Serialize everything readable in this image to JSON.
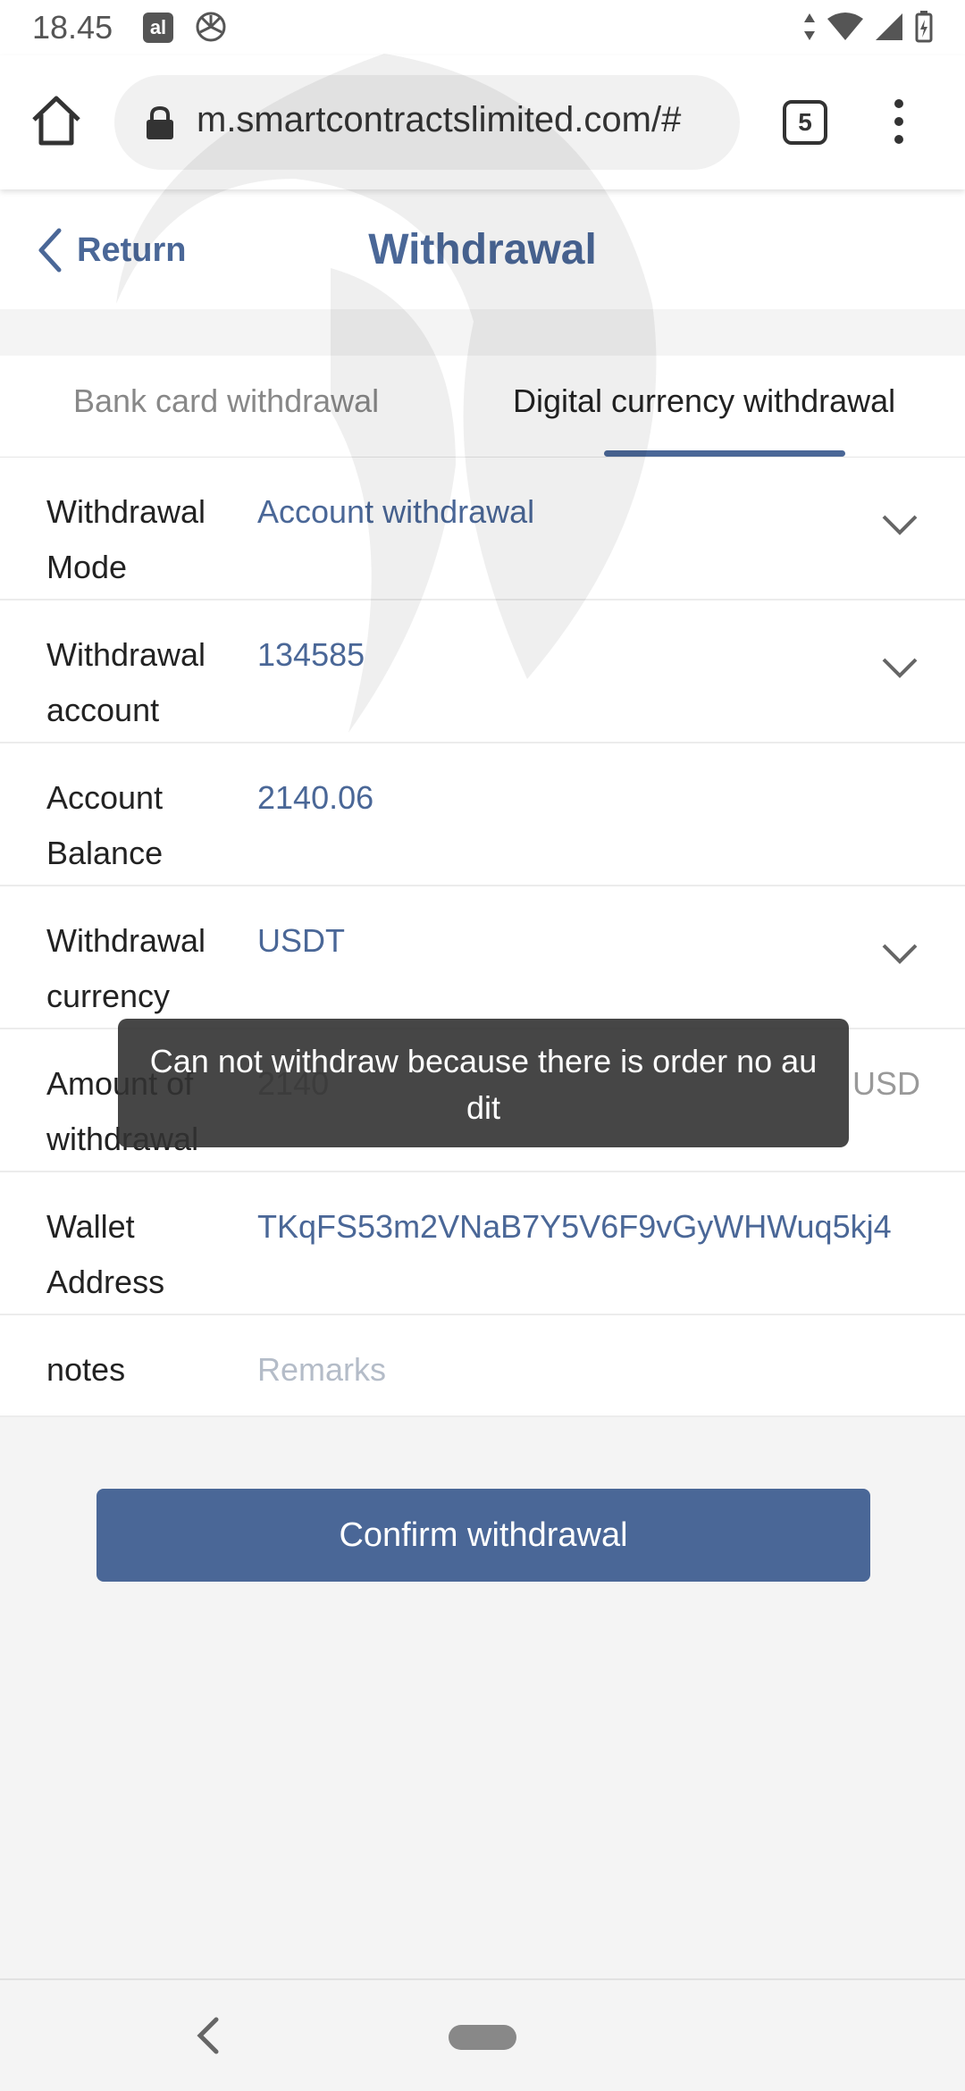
{
  "status_bar": {
    "time": "18.45",
    "app_icon_label": "al"
  },
  "browser": {
    "url": "m.smartcontractslimited.com/#",
    "tab_count": "5"
  },
  "header": {
    "return_label": "Return",
    "title": "Withdrawal"
  },
  "tabs": [
    {
      "label": "Bank card withdrawal",
      "active": false
    },
    {
      "label": "Digital currency withdrawal",
      "active": true
    }
  ],
  "form": {
    "withdrawal_mode": {
      "label": "Withdrawal Mode",
      "value": "Account withdrawal"
    },
    "withdrawal_account": {
      "label": "Withdrawal account",
      "value": "134585"
    },
    "account_balance": {
      "label": "Account Balance",
      "value": "2140.06"
    },
    "withdrawal_currency": {
      "label": "Withdrawal currency",
      "value": "USDT"
    },
    "amount": {
      "label": "Amount of withdrawal",
      "value": "2140",
      "unit": "USD"
    },
    "wallet_address": {
      "label": "Wallet Address",
      "value": "TKqFS53m2VNaB7Y5V6F9vGyWHWuq5kj4"
    },
    "notes": {
      "label": "notes",
      "placeholder": "Remarks"
    }
  },
  "confirm_button": "Confirm withdrawal",
  "toast": "Can not withdraw because there is order no audit",
  "colors": {
    "accent": "#4a6797",
    "toast_bg": "#323232"
  }
}
